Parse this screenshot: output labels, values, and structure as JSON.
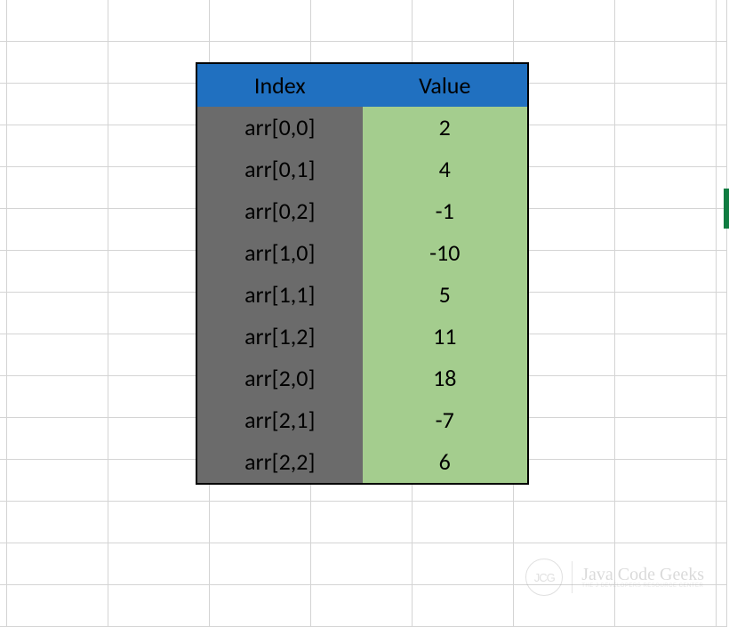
{
  "table": {
    "headers": {
      "index": "Index",
      "value": "Value"
    },
    "rows": [
      {
        "index": "arr[0,0]",
        "value": "2"
      },
      {
        "index": "arr[0,1]",
        "value": "4"
      },
      {
        "index": "arr[0,2]",
        "value": "-1"
      },
      {
        "index": "arr[1,0]",
        "value": "-10"
      },
      {
        "index": "arr[1,1]",
        "value": "5"
      },
      {
        "index": "arr[1,2]",
        "value": "11"
      },
      {
        "index": "arr[2,0]",
        "value": "18"
      },
      {
        "index": "arr[2,1]",
        "value": "-7"
      },
      {
        "index": "arr[2,2]",
        "value": "6"
      }
    ]
  },
  "watermark": {
    "icon": "JCG",
    "text": "Java Code Geeks",
    "subtext": "THE J DEVELOPERS RESOURCE CENTER"
  },
  "colors": {
    "header_bg": "#2070c0",
    "index_bg": "#6b6b6b",
    "value_bg": "#a4cd8e",
    "grid_line": "#d4d4d4",
    "green_marker": "#107c41"
  }
}
